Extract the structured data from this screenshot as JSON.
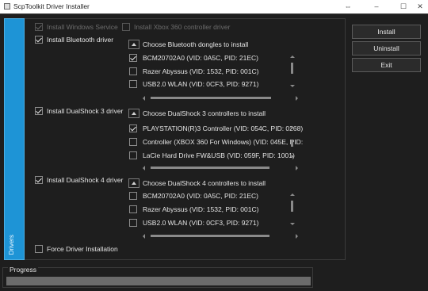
{
  "window": {
    "title": "ScpToolkit Driver Installer"
  },
  "titlebar_controls": {
    "pin": "⇔",
    "minimize": "–",
    "maximize": "☐",
    "close": "✕"
  },
  "tab": {
    "label": "Drivers"
  },
  "options": {
    "windows_service": {
      "label": "Install Windows Service",
      "checked": true,
      "enabled": false
    },
    "xbox360": {
      "label": "Install Xbox 360 controller driver",
      "checked": false,
      "enabled": false
    },
    "bluetooth": {
      "label": "Install Bluetooth driver",
      "checked": true
    },
    "ds3": {
      "label": "Install DualShock 3 driver",
      "checked": true
    },
    "ds4": {
      "label": "Install DualShock 4 driver",
      "checked": true
    },
    "force": {
      "label": "Force Driver Installation",
      "checked": false
    }
  },
  "groups": {
    "bluetooth": {
      "header": "Choose Bluetooth dongles to install",
      "devices": [
        {
          "label": "BCM20702A0 (VID: 0A5C, PID: 21EC)",
          "checked": true
        },
        {
          "label": "Razer Abyssus (VID: 1532, PID: 001C)",
          "checked": false
        },
        {
          "label": "USB2.0 WLAN (VID: 0CF3, PID: 9271)",
          "checked": false
        }
      ]
    },
    "ds3": {
      "header": "Choose DualShock 3 controllers to install",
      "devices": [
        {
          "label": "PLAYSTATION(R)3 Controller (VID: 054C, PID: 0268)",
          "checked": true
        },
        {
          "label": "Controller (XBOX 360 For Windows) (VID: 045E, PID:",
          "checked": false
        },
        {
          "label": "LaCie Hard Drive FW&USB (VID: 059F, PID: 1001)",
          "checked": false
        }
      ]
    },
    "ds4": {
      "header": "Choose DualShock 4 controllers to install",
      "devices": [
        {
          "label": "BCM20702A0 (VID: 0A5C, PID: 21EC)",
          "checked": false
        },
        {
          "label": "Razer Abyssus (VID: 1532, PID: 001C)",
          "checked": false
        },
        {
          "label": "USB2.0 WLAN (VID: 0CF3, PID: 9271)",
          "checked": false
        }
      ]
    }
  },
  "buttons": {
    "install": "Install",
    "uninstall": "Uninstall",
    "exit": "Exit"
  },
  "progress": {
    "label": "Progress",
    "value": 0
  },
  "colors": {
    "accent": "#1e94d6",
    "background": "#1e1e1e"
  }
}
